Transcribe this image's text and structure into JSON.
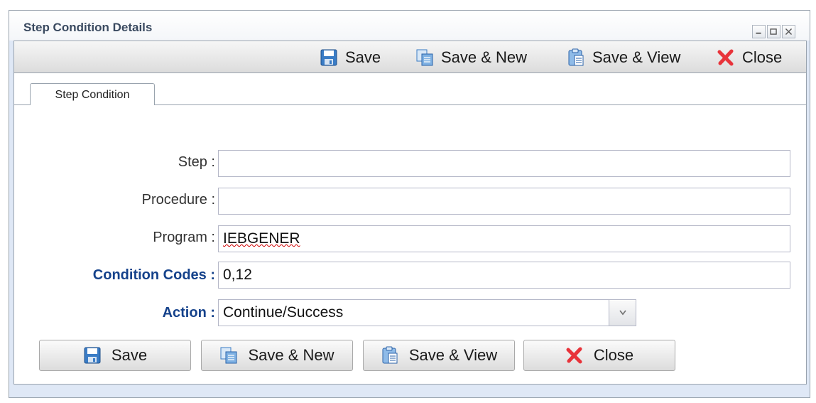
{
  "window": {
    "title": "Step Condition Details"
  },
  "toolbar": {
    "save_label": "Save",
    "save_new_label": "Save & New",
    "save_view_label": "Save & View",
    "close_label": "Close"
  },
  "tabs": [
    {
      "label": "Step Condition"
    }
  ],
  "form": {
    "step": {
      "label": "Step :",
      "value": ""
    },
    "procedure": {
      "label": "Procedure :",
      "value": ""
    },
    "program": {
      "label": "Program :",
      "value": "IEBGENER"
    },
    "condition_codes": {
      "label": "Condition Codes :",
      "value": "0,12"
    },
    "action": {
      "label": "Action :",
      "value": "Continue/Success"
    }
  },
  "buttons": {
    "save_label": "Save",
    "save_new_label": "Save & New",
    "save_view_label": "Save & View",
    "close_label": "Close"
  },
  "icons": {
    "save": "floppy-disk-icon",
    "save_new": "copy-documents-icon",
    "save_view": "clipboard-view-icon",
    "close": "red-x-icon"
  },
  "colors": {
    "bold_label": "#15428b",
    "close_icon": "#e8333a",
    "save_icon": "#2f6fb5"
  }
}
